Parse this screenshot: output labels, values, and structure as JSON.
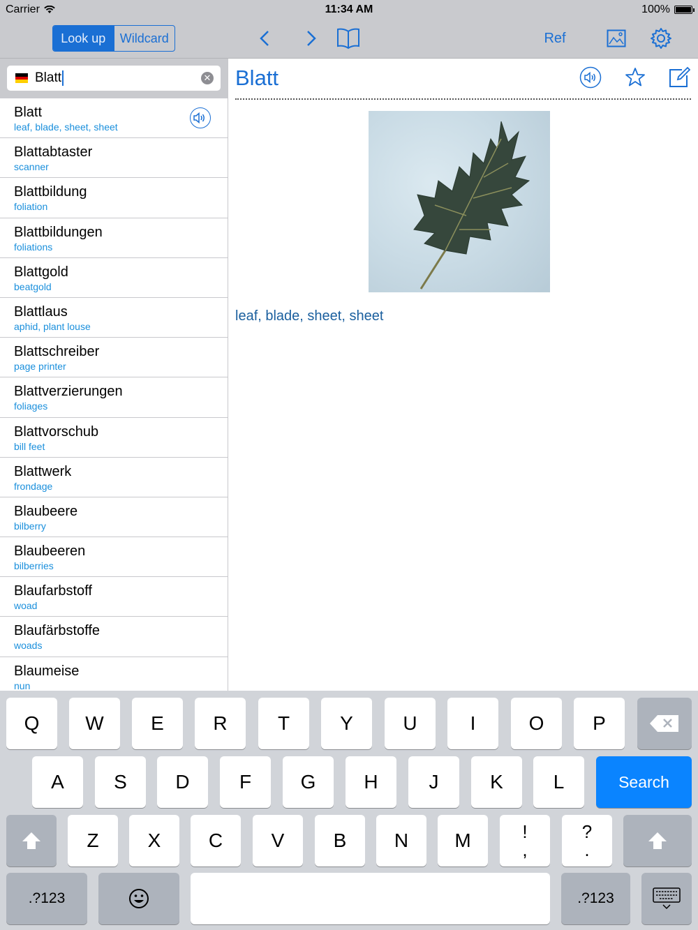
{
  "status_bar": {
    "carrier": "Carrier",
    "time": "11:34 AM",
    "battery": "100%"
  },
  "toolbar": {
    "segments": [
      "Look up",
      "Wildcard"
    ],
    "active_segment": "Look up",
    "ref_label": "Ref",
    "icons": [
      "chevron-left-icon",
      "chevron-right-icon",
      "book-icon",
      "image-icon",
      "gear-icon"
    ]
  },
  "search": {
    "value": "Blatt",
    "language_flag": "german-flag-icon"
  },
  "results": [
    {
      "headword": "Blatt",
      "translation": "leaf, blade, sheet, sheet"
    },
    {
      "headword": "Blattabtaster",
      "translation": "scanner"
    },
    {
      "headword": "Blattbildung",
      "translation": "foliation"
    },
    {
      "headword": "Blattbildungen",
      "translation": "foliations"
    },
    {
      "headword": "Blattgold",
      "translation": "beatgold"
    },
    {
      "headword": "Blattlaus",
      "translation": "aphid, plant louse"
    },
    {
      "headword": "Blattschreiber",
      "translation": "page printer"
    },
    {
      "headword": "Blattverzierungen",
      "translation": "foliages"
    },
    {
      "headword": "Blattvorschub",
      "translation": "bill feet"
    },
    {
      "headword": "Blattwerk",
      "translation": "frondage"
    },
    {
      "headword": "Blaubeere",
      "translation": "bilberry"
    },
    {
      "headword": "Blaubeeren",
      "translation": "bilberries"
    },
    {
      "headword": "Blaufarbstoff",
      "translation": "woad"
    },
    {
      "headword": "Blaufärbstoffe",
      "translation": "woads"
    },
    {
      "headword": "Blaumeise",
      "translation": "nun"
    }
  ],
  "entry": {
    "title": "Blatt",
    "definition": "leaf, blade, sheet, sheet",
    "image": "leaf-photo"
  },
  "keyboard": {
    "row1": [
      "Q",
      "W",
      "E",
      "R",
      "T",
      "Y",
      "U",
      "I",
      "O",
      "P"
    ],
    "row2": [
      "A",
      "S",
      "D",
      "F",
      "G",
      "H",
      "J",
      "K",
      "L"
    ],
    "row3": [
      "Z",
      "X",
      "C",
      "V",
      "B",
      "N",
      "M"
    ],
    "punct1": [
      "!",
      ","
    ],
    "punct2": [
      "?",
      "."
    ],
    "search_label": "Search",
    "numbers_label": ".?123"
  },
  "colors": {
    "accent": "#1a6fd4",
    "translation": "#1a8fdc",
    "toolbar_bg": "#c9cace",
    "search_key": "#0a84ff"
  }
}
